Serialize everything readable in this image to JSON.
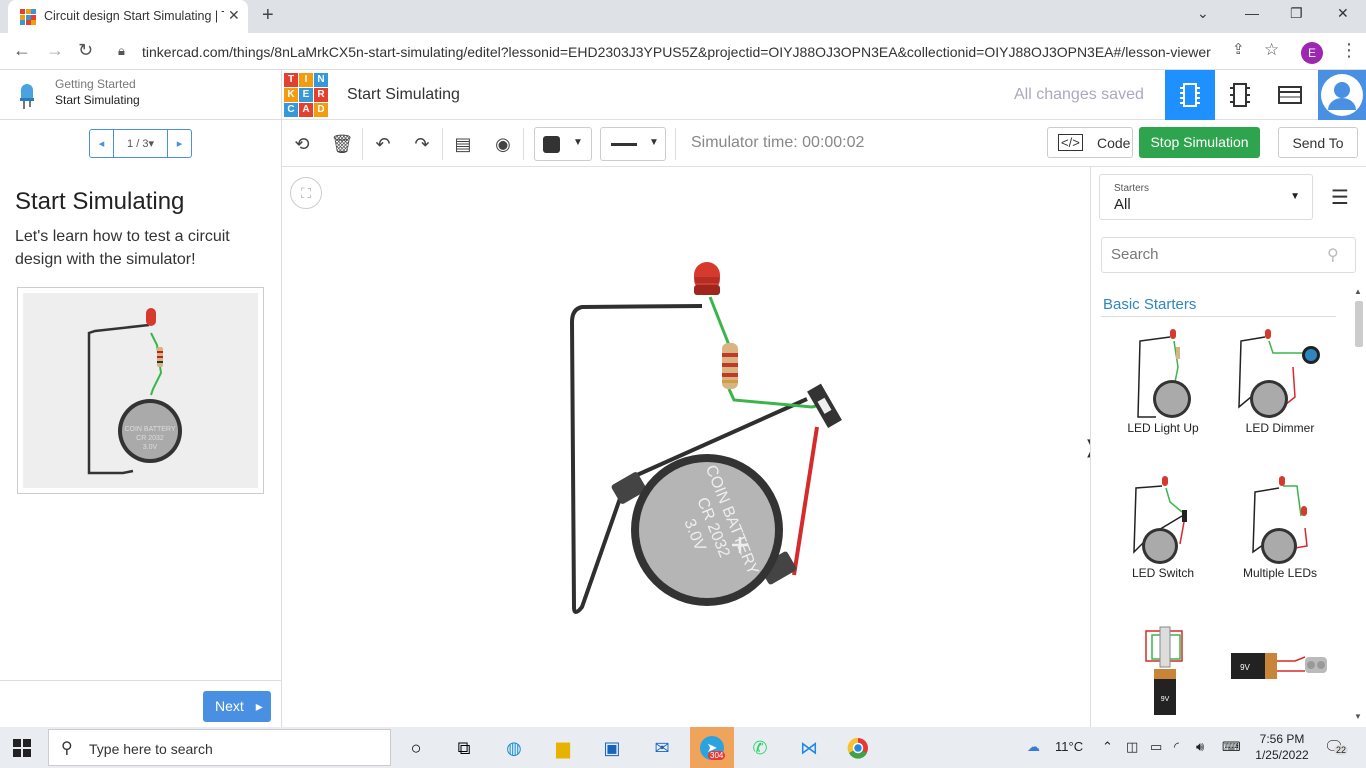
{
  "browser": {
    "tab_title": "Circuit design Start Simulating | T",
    "tab_close": "✕",
    "new_tab": "+",
    "url": "tinkercad.com/things/8nLaMrkCX5n-start-simulating/editel?lessonid=EHD2303J3YPUS5Z&projectid=OIYJ88OJ3OPN3EA&collectionid=OIYJ88OJ3OPN3EA#/lesson-viewer",
    "profile_letter": "E"
  },
  "lesson": {
    "breadcrumb_parent": "Getting Started",
    "breadcrumb_current": "Start Simulating",
    "pager": "1 / 3",
    "title": "Start Simulating",
    "description": "Let's learn how to test a circuit design with the simulator!",
    "next_label": "Next",
    "image_battery_text": "COIN BATTERY",
    "image_battery_model": "CR 2032",
    "image_battery_voltage": "3.0V"
  },
  "header": {
    "logo_letters": [
      "T",
      "I",
      "N",
      "K",
      "E",
      "R",
      "C",
      "A",
      "D"
    ],
    "logo_colors": [
      "#e2412f",
      "#f39c12",
      "#3498db",
      "#f39c12",
      "#3498db",
      "#e2412f",
      "#3498db",
      "#e2412f",
      "#f39c12"
    ],
    "title": "Start Simulating",
    "save_status": "All changes saved"
  },
  "toolbar": {
    "sim_time": "Simulator time: 00:00:02",
    "code_label": "Code",
    "stop_label": "Stop Simulation",
    "send_label": "Send To"
  },
  "circuit": {
    "battery_text": "COIN BATTERY",
    "battery_model": "CR 2032",
    "battery_voltage": "3.0V"
  },
  "components_panel": {
    "starters_label": "Starters",
    "starters_value": "All",
    "search_placeholder": "Search",
    "section": "Basic Starters",
    "starters": [
      "LED Light Up",
      "LED Dimmer",
      "LED Switch",
      "Multiple LEDs"
    ],
    "nine_volt": "9V"
  },
  "taskbar": {
    "search_placeholder": "Type here to search",
    "weather": "11°C",
    "time": "7:56 PM",
    "date": "1/25/2022",
    "telegram_badge": "304",
    "notif_count": "22"
  }
}
